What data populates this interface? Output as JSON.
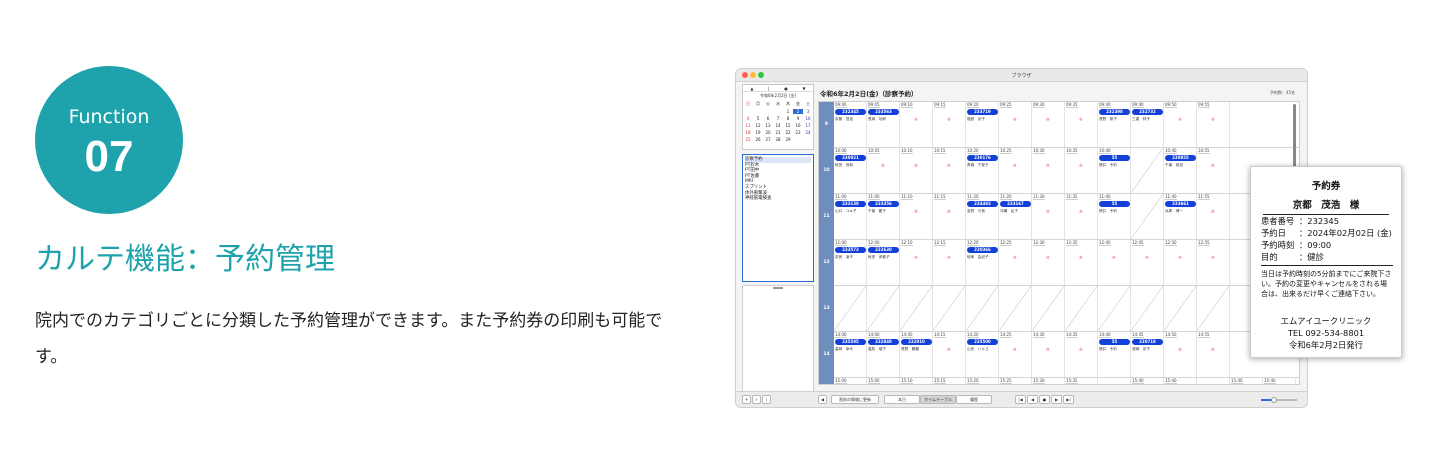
{
  "badge": {
    "label": "Function",
    "number": "07"
  },
  "heading": "カルテ機能：予約管理",
  "description": "院内でのカテゴリごとに分類した予約管理ができます。また予約券の印刷も可能です。",
  "window": {
    "title": "ブラウザ",
    "date_title": "令和6年2月2日(金)（診察予約）",
    "count": "予約数：45名",
    "calendar": {
      "nav": [
        "▲",
        "|",
        "●",
        "▼"
      ],
      "caption": "令和6年2月2日 (金)",
      "weekdays": [
        "日",
        "月",
        "火",
        "水",
        "木",
        "金",
        "土"
      ],
      "days": [
        "",
        "",
        "",
        "",
        "1",
        "2",
        "3",
        "4",
        "5",
        "6",
        "7",
        "8",
        "9",
        "10",
        "11",
        "12",
        "13",
        "14",
        "15",
        "16",
        "17",
        "18",
        "19",
        "20",
        "21",
        "22",
        "23",
        "24",
        "25",
        "26",
        "27",
        "28",
        "29",
        "",
        ""
      ],
      "selected": "2"
    },
    "categories": [
      "診察予約",
      "PT鈴木",
      "PT田中",
      "PT佐藤",
      "MRI",
      "スプリント",
      "体外衝撃波",
      "神経筋電検査"
    ],
    "rows": [
      {
        "hour": "9",
        "cells": [
          {
            "time": "09:00",
            "pid": "232345",
            "name": "京都　茂浩"
          },
          {
            "time": "09:05",
            "pid": "233563",
            "name": "長岡　功郎"
          },
          {
            "time": "09:10",
            "mark": "※"
          },
          {
            "time": "09:15",
            "mark": "※"
          },
          {
            "time": "09:20",
            "pid": "233719",
            "name": "福島　京子"
          },
          {
            "time": "09:25",
            "mark": "※"
          },
          {
            "time": "09:30",
            "mark": "※"
          },
          {
            "time": "09:35",
            "mark": "※"
          },
          {
            "time": "09:40",
            "pid": "232398",
            "name": "長野　那子"
          },
          {
            "time": "09:40",
            "pid": "232732",
            "name": "三重　絆子"
          },
          {
            "time": "09:50",
            "mark": "※"
          },
          {
            "time": "09:55",
            "mark": "※"
          }
        ]
      },
      {
        "hour": "10",
        "cells": [
          {
            "time": "10:00",
            "pid": "230021",
            "name": "秋田　良和"
          },
          {
            "time": "10:05",
            "mark": "※"
          },
          {
            "time": "10:10",
            "mark": "※"
          },
          {
            "time": "10:15",
            "mark": "※"
          },
          {
            "time": "10:20",
            "pid": "230176",
            "name": "青森　千夏子"
          },
          {
            "time": "10:25",
            "mark": "※"
          },
          {
            "time": "10:30",
            "mark": "※"
          },
          {
            "time": "10:35",
            "mark": "※"
          },
          {
            "time": "10:40",
            "pid": "55",
            "name": "徳井　予約"
          },
          {
            "time": "",
            "slash": true
          },
          {
            "time": "10:40",
            "pid": "230855",
            "name": "千葉　琉滋"
          },
          {
            "time": "10:55",
            "mark": "※"
          }
        ]
      },
      {
        "hour": "11",
        "cells": [
          {
            "time": "11:00",
            "pid": "233138",
            "name": "山口　ユキ子"
          },
          {
            "time": "11:00",
            "pid": "233356",
            "name": "千葉　龍子"
          },
          {
            "time": "11:10",
            "mark": "※"
          },
          {
            "time": "11:15",
            "mark": "※"
          },
          {
            "time": "11:20",
            "pid": "234483",
            "name": "滋賀　沙良"
          },
          {
            "time": "11:20",
            "pid": "233167",
            "name": "沖縄　弘子"
          },
          {
            "time": "11:30",
            "mark": "※"
          },
          {
            "time": "11:35",
            "mark": "※"
          },
          {
            "time": "11:40",
            "pid": "55",
            "name": "徳井　予約"
          },
          {
            "time": "",
            "slash": true
          },
          {
            "time": "11:40",
            "pid": "233661",
            "name": "兵庫　博一"
          },
          {
            "time": "11:55",
            "mark": "※"
          }
        ]
      },
      {
        "hour": "12",
        "cells": [
          {
            "time": "12:00",
            "pid": "233573",
            "name": "奈良　凌子"
          },
          {
            "time": "12:00",
            "pid": "232630",
            "name": "秋田　伊都子"
          },
          {
            "time": "12:10",
            "mark": "※"
          },
          {
            "time": "12:15",
            "mark": "※"
          },
          {
            "time": "12:20",
            "pid": "230366",
            "name": "岐阜　由紀子"
          },
          {
            "time": "12:25",
            "mark": "※"
          },
          {
            "time": "12:30",
            "mark": "※"
          },
          {
            "time": "12:35",
            "mark": "※"
          },
          {
            "time": "12:40",
            "mark": "※"
          },
          {
            "time": "12:45",
            "mark": "※"
          },
          {
            "time": "12:50",
            "mark": "※"
          },
          {
            "time": "12:55",
            "mark": "※"
          }
        ]
      },
      {
        "hour": "13",
        "cells": [
          {
            "time": "",
            "slash": true
          },
          {
            "time": "",
            "slash": true
          },
          {
            "time": "",
            "slash": true
          },
          {
            "time": "",
            "slash": true
          },
          {
            "time": "",
            "slash": true
          },
          {
            "time": "",
            "slash": true
          },
          {
            "time": "",
            "slash": true
          },
          {
            "time": "",
            "slash": true
          },
          {
            "time": "",
            "slash": true
          },
          {
            "time": "",
            "slash": true
          },
          {
            "time": "",
            "slash": true
          },
          {
            "time": "",
            "slash": true
          }
        ]
      },
      {
        "hour": "14",
        "cells": [
          {
            "time": "14:00",
            "pid": "235585",
            "name": "高岡　幸代"
          },
          {
            "time": "14:00",
            "pid": "232849",
            "name": "高知　瑞子"
          },
          {
            "time": "14:00",
            "pid": "232910",
            "name": "長野　勝義"
          },
          {
            "time": "14:15",
            "mark": "※"
          },
          {
            "time": "14:20",
            "pid": "235500",
            "name": "山形　ハルヨ"
          },
          {
            "time": "14:25",
            "mark": "※"
          },
          {
            "time": "14:30",
            "mark": "※"
          },
          {
            "time": "14:35",
            "mark": "※"
          },
          {
            "time": "14:40",
            "pid": "55",
            "name": "徳井　予約"
          },
          {
            "time": "14:45",
            "pid": "230719",
            "name": "宮崎　奈子"
          },
          {
            "time": "14:50",
            "mark": "※"
          },
          {
            "time": "14:55",
            "mark": "※"
          }
        ]
      },
      {
        "hour": "15",
        "cells": [
          {
            "time": "15:00"
          },
          {
            "time": "15:00"
          },
          {
            "time": "15:10"
          },
          {
            "time": "15:15"
          },
          {
            "time": "15:20"
          },
          {
            "time": "15:25"
          },
          {
            "time": "15:30"
          },
          {
            "time": "15:35"
          },
          {
            "time": ""
          },
          {
            "time": "15:40"
          },
          {
            "time": "15:40"
          },
          {
            "time": ""
          },
          {
            "time": "15:40"
          },
          {
            "time": "15:40"
          }
        ]
      }
    ],
    "bottom": {
      "add": "+",
      "check": "✓",
      "info": "i",
      "prev": "◀",
      "reflect_label": "直前の情報に更新",
      "views": [
        "本日",
        "タイムテーブル",
        "履歴"
      ],
      "nav": [
        "|◀",
        "◀",
        "●",
        "▶",
        "▶|"
      ],
      "zoom": 0.35
    }
  },
  "ticket": {
    "title": "予約券",
    "name": "京都　茂浩　様",
    "rows": [
      {
        "k": "患者番号",
        "v": "：232345"
      },
      {
        "k": "予約日",
        "v": "：2024年02月02日 (金)"
      },
      {
        "k": "予約時刻",
        "v": "：09:00"
      },
      {
        "k": "目的",
        "v": "：健診"
      }
    ],
    "note": "当日は予約時刻の5分前までにご来院下さい。予約の変更やキャンセルをされる場合は、出来るだけ早くご連絡下さい。",
    "clinic": "エムアイユークリニック",
    "tel": "TEL 092-534-8801",
    "issued": "令和6年2月2日発行"
  }
}
